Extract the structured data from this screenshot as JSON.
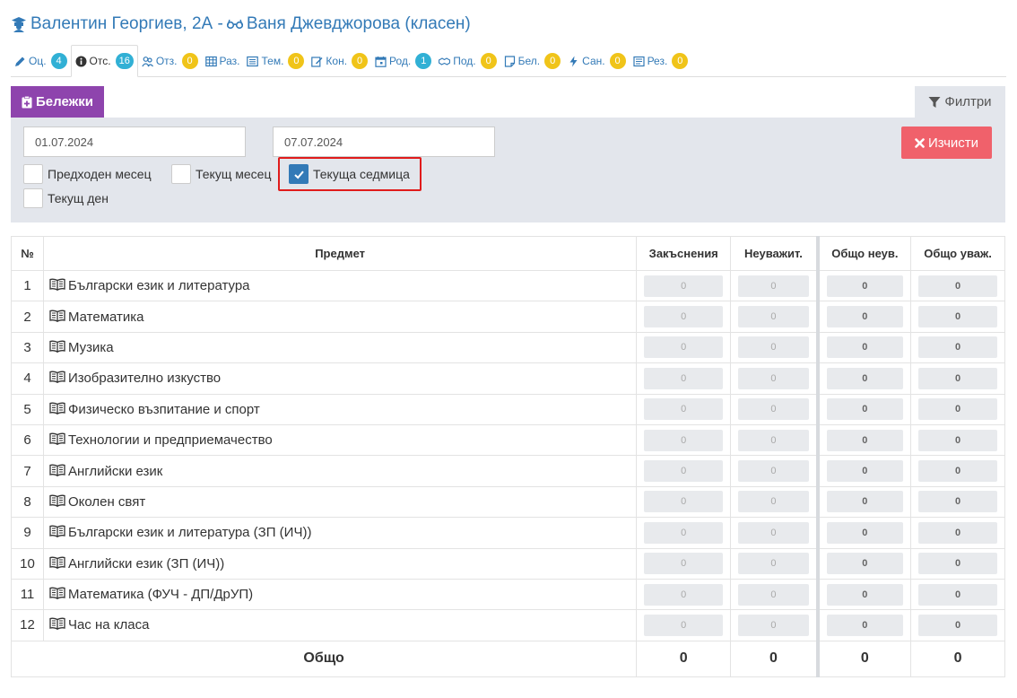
{
  "header": {
    "student": "Валентин Георгиев, 2А -",
    "teacher": "Ваня Джевджорова (класен)"
  },
  "tabs": [
    {
      "label": "Оц.",
      "badge": "4",
      "badge_color": "teal",
      "icon": "pencil-icon"
    },
    {
      "label": "Отс.",
      "badge": "16",
      "badge_color": "teal",
      "icon": "info-circle-icon",
      "active": true
    },
    {
      "label": "Отз.",
      "badge": "0",
      "badge_color": "yellow",
      "icon": "users-icon"
    },
    {
      "label": "Раз.",
      "icon": "table-icon"
    },
    {
      "label": "Тем.",
      "badge": "0",
      "badge_color": "yellow",
      "icon": "list-icon"
    },
    {
      "label": "Кон.",
      "badge": "0",
      "badge_color": "yellow",
      "icon": "edit-icon"
    },
    {
      "label": "Род.",
      "badge": "1",
      "badge_color": "teal",
      "icon": "calendar-icon"
    },
    {
      "label": "Под.",
      "badge": "0",
      "badge_color": "yellow",
      "icon": "handshake-icon"
    },
    {
      "label": "Бел.",
      "badge": "0",
      "badge_color": "yellow",
      "icon": "note-icon"
    },
    {
      "label": "Сан.",
      "badge": "0",
      "badge_color": "yellow",
      "icon": "bolt-icon"
    },
    {
      "label": "Рез.",
      "badge": "0",
      "badge_color": "yellow",
      "icon": "newspaper-icon"
    }
  ],
  "notes_button": "Бележки",
  "filters_tab": "Филтри",
  "filters": {
    "date_from": "01.07.2024",
    "date_to": "07.07.2024",
    "clear_label": "Изчисти",
    "prev_month": "Предходен месец",
    "current_month": "Текущ месец",
    "current_week": "Текуща седмица",
    "current_week_checked": true,
    "current_day": "Текущ ден"
  },
  "table": {
    "headers": [
      "№",
      "Предмет",
      "Закъснения",
      "Неуважит.",
      "Общо неув.",
      "Общо уваж."
    ],
    "rows": [
      {
        "n": "1",
        "subject": "Български език и литература",
        "late": "0",
        "unexcused": "0",
        "total_unexcused": "0",
        "total_excused": "0"
      },
      {
        "n": "2",
        "subject": "Математика",
        "late": "0",
        "unexcused": "0",
        "total_unexcused": "0",
        "total_excused": "0"
      },
      {
        "n": "3",
        "subject": "Музика",
        "late": "0",
        "unexcused": "0",
        "total_unexcused": "0",
        "total_excused": "0"
      },
      {
        "n": "4",
        "subject": "Изобразително изкуство",
        "late": "0",
        "unexcused": "0",
        "total_unexcused": "0",
        "total_excused": "0"
      },
      {
        "n": "5",
        "subject": "Физическо възпитание и спорт",
        "late": "0",
        "unexcused": "0",
        "total_unexcused": "0",
        "total_excused": "0"
      },
      {
        "n": "6",
        "subject": "Технологии и предприемачество",
        "late": "0",
        "unexcused": "0",
        "total_unexcused": "0",
        "total_excused": "0"
      },
      {
        "n": "7",
        "subject": "Английски език",
        "late": "0",
        "unexcused": "0",
        "total_unexcused": "0",
        "total_excused": "0"
      },
      {
        "n": "8",
        "subject": "Околен свят",
        "late": "0",
        "unexcused": "0",
        "total_unexcused": "0",
        "total_excused": "0"
      },
      {
        "n": "9",
        "subject": "Български език и литература (ЗП (ИЧ))",
        "late": "0",
        "unexcused": "0",
        "total_unexcused": "0",
        "total_excused": "0"
      },
      {
        "n": "10",
        "subject": "Английски език (ЗП (ИЧ))",
        "late": "0",
        "unexcused": "0",
        "total_unexcused": "0",
        "total_excused": "0"
      },
      {
        "n": "11",
        "subject": "Математика (ФУЧ - ДП/ДрУП)",
        "late": "0",
        "unexcused": "0",
        "total_unexcused": "0",
        "total_excused": "0"
      },
      {
        "n": "12",
        "subject": "Час на класа",
        "late": "0",
        "unexcused": "0",
        "total_unexcused": "0",
        "total_excused": "0"
      }
    ],
    "total": {
      "label": "Общо",
      "late": "0",
      "unexcused": "0",
      "total_unexcused": "0",
      "total_excused": "0"
    }
  }
}
